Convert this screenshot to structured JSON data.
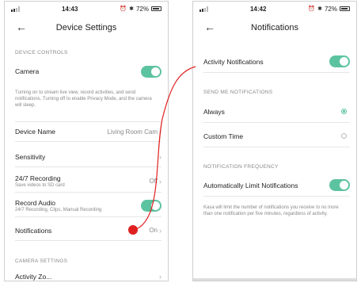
{
  "left": {
    "status": {
      "time": "14:43",
      "battery": "72%"
    },
    "title": "Device Settings",
    "section_device_controls": "DEVICE CONTROLS",
    "camera_label": "Camera",
    "camera_desc": "Turning on to stream live view, record activities, and send notifications. Turning off to enable Privacy Mode, and the camera will sleep.",
    "device_name_label": "Device Name",
    "device_name_value": "Living Room Cam",
    "sensitivity_label": "Sensitivity",
    "recording_label": "24/7 Recording",
    "recording_sub": "Save videos to SD card",
    "recording_value": "Off",
    "record_audio_label": "Record Audio",
    "record_audio_sub": "24/7 Recording, Clips, Manual Recording",
    "notifications_label": "Notifications",
    "notifications_value": "On",
    "section_camera_settings": "CAMERA SETTINGS",
    "partial_row_label": "Activity Zo..."
  },
  "right": {
    "status": {
      "time": "14:42",
      "battery": "72%"
    },
    "title": "Notifications",
    "activity_label": "Activity Notifications",
    "section_send_me": "SEND ME NOTIFICATIONS",
    "always_label": "Always",
    "custom_time_label": "Custom Time",
    "section_frequency": "NOTIFICATION FREQUENCY",
    "auto_limit_label": "Automatically Limit Notifications",
    "auto_limit_desc": "Kasa will limit the number of notifications you receive to no more than one notification per five minutes, regardless of activity."
  },
  "colors": {
    "accent": "#5cc3a0",
    "annotation": "#e02020"
  },
  "icons": {
    "back": "back-arrow-icon",
    "chevron": "chevron-right-icon"
  }
}
